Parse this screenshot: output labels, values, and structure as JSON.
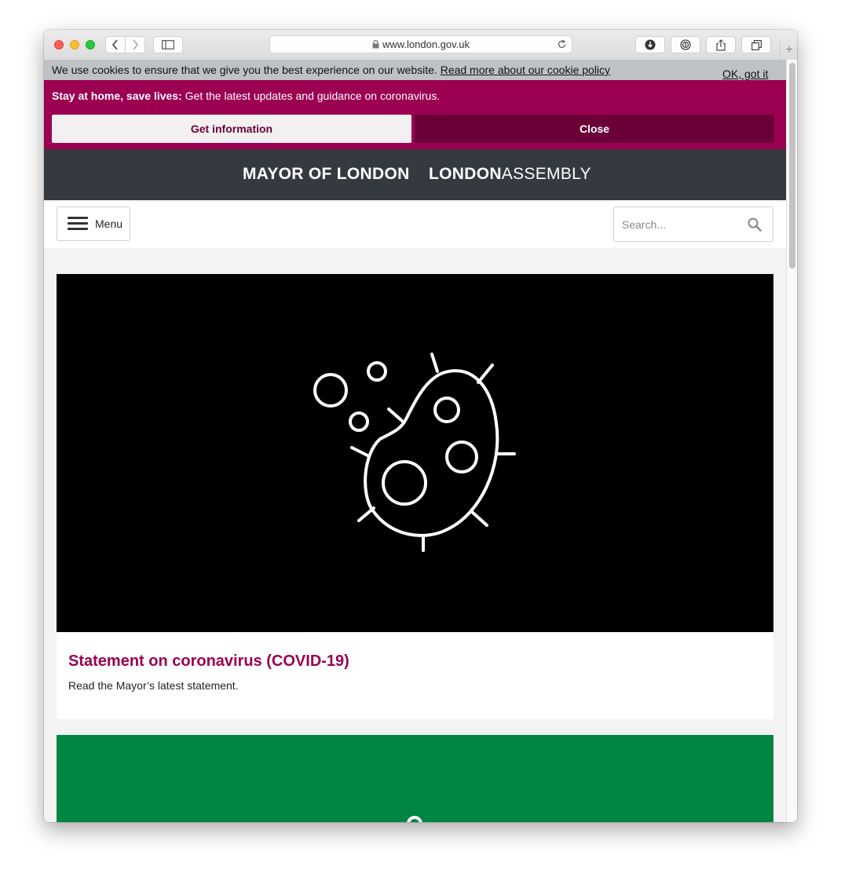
{
  "browser": {
    "url": "www.london.gov.uk"
  },
  "cookie_banner": {
    "message": "We use cookies to ensure that we give you the best experience on our website.",
    "link_text": "Read more about our cookie policy",
    "dismiss_label": "OK, got it"
  },
  "alert": {
    "bold_text": "Stay at home, save lives:",
    "text": " Get the latest updates and guidance on coronavirus.",
    "primary_button": "Get information",
    "secondary_button": "Close"
  },
  "masthead": {
    "mayor": "MAYOR OF LONDON",
    "assembly_bold": "LONDON",
    "assembly_light": "ASSEMBLY"
  },
  "nav": {
    "menu_label": "Menu",
    "search_placeholder": "Search..."
  },
  "cards": [
    {
      "title": "Statement on coronavirus (COVID-19)",
      "description": "Read the Mayor’s latest statement.",
      "image_icon": "virus-icon"
    },
    {
      "image_icon": "partial-icon"
    }
  ],
  "colors": {
    "alert": "#9b0051",
    "alert_dark": "#6b0038",
    "masthead": "#353a40",
    "card_green": "#008542"
  }
}
